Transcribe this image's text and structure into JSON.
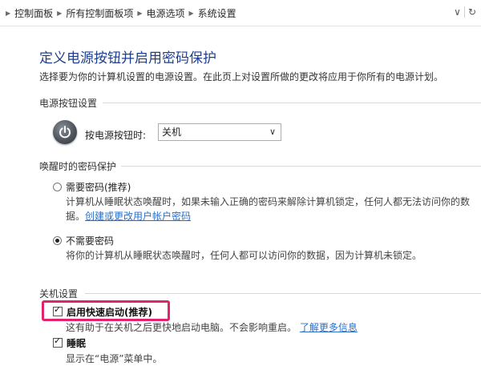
{
  "breadcrumb": [
    "控制面板",
    "所有控制面板项",
    "电源选项",
    "系统设置"
  ],
  "address_controls": {
    "dropdown_glyph": "∨",
    "refresh_glyph": "↻"
  },
  "page": {
    "title": "定义电源按钮并启用密码保护",
    "subtitle": "选择要为你的计算机设置的电源设置。在此页上对设置所做的更改将应用于你所有的电源计划。"
  },
  "power_button": {
    "group_label": "电源按钮设置",
    "label": "按电源按钮时:",
    "selected": "关机"
  },
  "wake_password": {
    "group_label": "唤醒时的密码保护",
    "options": [
      {
        "label": "需要密码(推荐)",
        "desc1": "计算机从睡眠状态唤醒时，如果未输入正确的密码来解除计算机锁定，任何人都无法访问你的数",
        "desc2": "据。",
        "link": "创建或更改用户帐户密码",
        "checked": false
      },
      {
        "label": "不需要密码",
        "desc1": "将你的计算机从睡眠状态唤醒时，任何人都可以访问你的数据，因为计算机未锁定。",
        "checked": true
      }
    ]
  },
  "shutdown": {
    "group_label": "关机设置",
    "fast_startup": {
      "label": "启用快速启动(推荐)",
      "desc": "这有助于在关机之后更快地启动电脑。不会影响重启。",
      "link": "了解更多信息",
      "checked": true
    },
    "sleep": {
      "label": "睡眠",
      "desc": "显示在“电源”菜单中。",
      "checked": true
    }
  },
  "colors": {
    "title": "#1e3f8f",
    "link": "#2a6fc9",
    "highlight": "#e0236c"
  }
}
